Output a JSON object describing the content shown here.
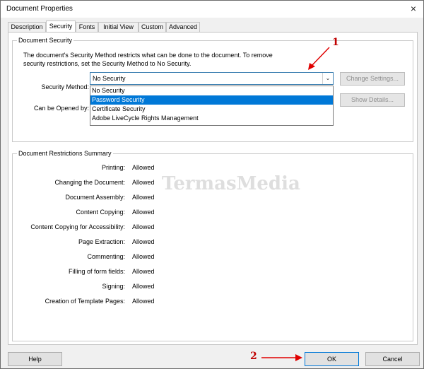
{
  "window": {
    "title": "Document Properties",
    "close_glyph": "×"
  },
  "tabs": [
    {
      "label": "Description",
      "active": false
    },
    {
      "label": "Security",
      "active": true
    },
    {
      "label": "Fonts",
      "active": false
    },
    {
      "label": "Initial View",
      "active": false
    },
    {
      "label": "Custom",
      "active": false
    },
    {
      "label": "Advanced",
      "active": false
    }
  ],
  "security": {
    "group_title": "Document Security",
    "description_line1": "The document's Security Method restricts what can be done to the document. To remove",
    "description_line2": "security restrictions, set the Security Method to No Security.",
    "method_label": "Security Method:",
    "method_value": "No Security",
    "opened_by_label": "Can be Opened by:",
    "options": [
      "No Security",
      "Password Security",
      "Certificate Security",
      "Adobe LiveCycle Rights Management"
    ],
    "highlighted_option": "Password Security",
    "change_settings_label": "Change Settings...",
    "show_details_label": "Show Details..."
  },
  "restrictions": {
    "group_title": "Document Restrictions Summary",
    "rows": [
      {
        "label": "Printing:",
        "value": "Allowed"
      },
      {
        "label": "Changing the Document:",
        "value": "Allowed"
      },
      {
        "label": "Document Assembly:",
        "value": "Allowed"
      },
      {
        "label": "Content Copying:",
        "value": "Allowed"
      },
      {
        "label": "Content Copying for Accessibility:",
        "value": "Allowed"
      },
      {
        "label": "Page Extraction:",
        "value": "Allowed"
      },
      {
        "label": "Commenting:",
        "value": "Allowed"
      },
      {
        "label": "Filling of form fields:",
        "value": "Allowed"
      },
      {
        "label": "Signing:",
        "value": "Allowed"
      },
      {
        "label": "Creation of Template Pages:",
        "value": "Allowed"
      }
    ]
  },
  "footer": {
    "help_label": "Help",
    "ok_label": "OK",
    "cancel_label": "Cancel"
  },
  "annotations": {
    "marker1": "1",
    "marker2": "2",
    "arrow_color": "#e00000"
  },
  "watermark": "TermasMedia"
}
